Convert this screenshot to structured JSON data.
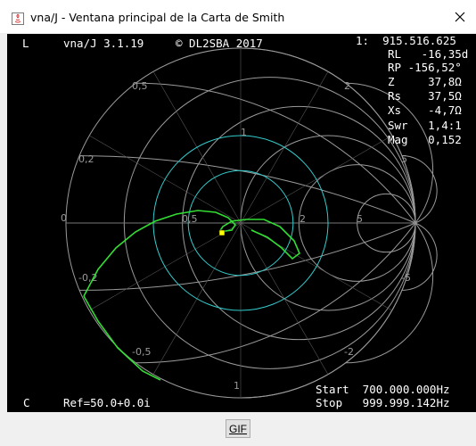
{
  "window": {
    "title": "vna/J - Ventana principal de la Carta de Smith"
  },
  "chart_header": {
    "mode": "L",
    "app_version": "vna/J 3.1.19",
    "copyright": "© DL2SBA 2017"
  },
  "marker_readout": {
    "marker_frequency": "1:  915.516.625",
    "rl": "RL   -16,35d",
    "rp": "RP -156,52°",
    "z": "Z     37,8Ω",
    "rs": "Rs    37,5Ω",
    "xs": "Xs    -4,7Ω",
    "swr": "Swr   1,4:1",
    "mag": "Mag   0,152"
  },
  "footer_readout": {
    "calibration": "C",
    "reference": "Ref=50.0+0.0i",
    "start": "Start  700.000.000Hz",
    "stop": "Stop   999.999.142Hz"
  },
  "chart_data": {
    "type": "smith",
    "grid_labels": [
      "0,5",
      "2",
      "0,2",
      "5",
      "0",
      "0,5",
      "2",
      "5",
      "-0,2",
      "-5",
      "-0,5",
      "-2",
      "1",
      "1"
    ],
    "swr_circles": [
      0.3,
      0.5
    ],
    "trace_color": "#33dd33",
    "grid_color": "#9a9a9a",
    "swr_circle_color": "#33cccc",
    "trace": [
      {
        "r": 0.47,
        "x": -0.46
      },
      {
        "r": 0.8,
        "x": -0.25
      },
      {
        "r": 1.35,
        "x": -0.12
      },
      {
        "r": 1.8,
        "x": -0.32
      },
      {
        "r": 1.64,
        "x": -0.06
      },
      {
        "r": 1.43,
        "x": 0.12
      },
      {
        "r": 1.09,
        "x": 0.08
      },
      {
        "r": 0.97,
        "x": -0.12
      },
      {
        "r": 0.88,
        "x": 0.2
      },
      {
        "r": 0.73,
        "x": -0.14
      },
      {
        "r": 0.55,
        "x": 0.23
      },
      {
        "r": 0.31,
        "x": 0.23
      },
      {
        "r": 0.18,
        "x": 0.25
      },
      {
        "r": 0.0,
        "x": -0.49
      }
    ],
    "marker": {
      "r": 0.756,
      "x": -0.094
    }
  },
  "buttons": {
    "gif_label": "GIF"
  }
}
